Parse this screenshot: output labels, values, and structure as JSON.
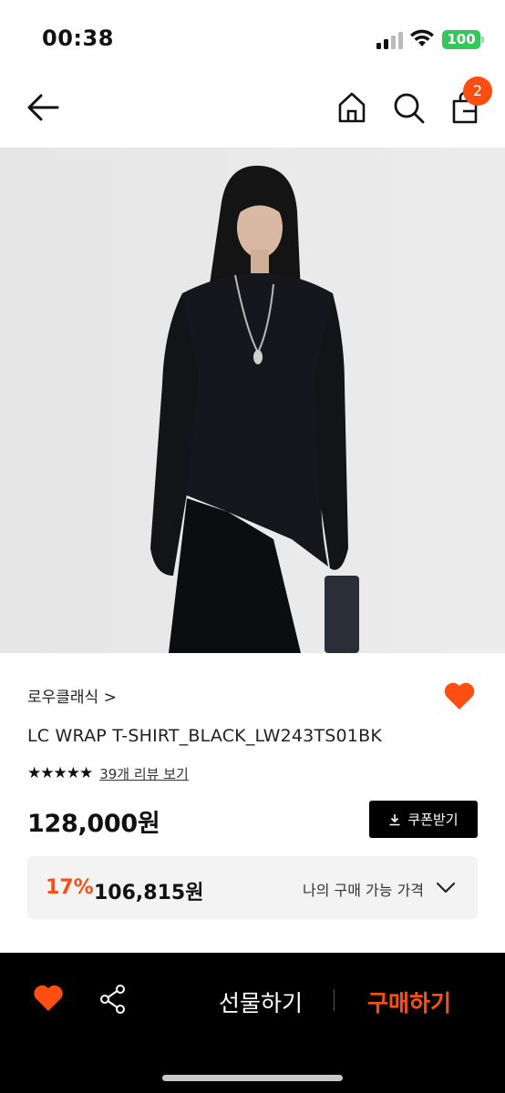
{
  "status_bar": {
    "time": "00:38",
    "battery": "100",
    "battery_color": "#34c759"
  },
  "nav": {
    "back_icon": "arrow-left-icon",
    "home_icon": "home-icon",
    "search_icon": "search-icon",
    "cart_icon": "shopping-bag-icon",
    "cart_count": "2"
  },
  "product": {
    "image_icon": "product-photo",
    "brand": "로우클래식 >",
    "name": "LC WRAP T-SHIRT_BLACK_LW243TS01BK",
    "rating": 4.5,
    "stars": "★★★★★",
    "review_link": "39개 리뷰 보기",
    "price": "128,000원",
    "coupon_button": "쿠폰받기",
    "wishlisted": true
  },
  "best_price": {
    "discount_rate": "17%",
    "discount_price": "106,815원",
    "label": "나의 구매 가능 가격"
  },
  "bottom_bar": {
    "gift_label": "선물하기",
    "buy_label": "구매하기"
  },
  "colors": {
    "accent": "#ff4e12",
    "black": "#000000",
    "box_bg": "#f3f3f3"
  }
}
